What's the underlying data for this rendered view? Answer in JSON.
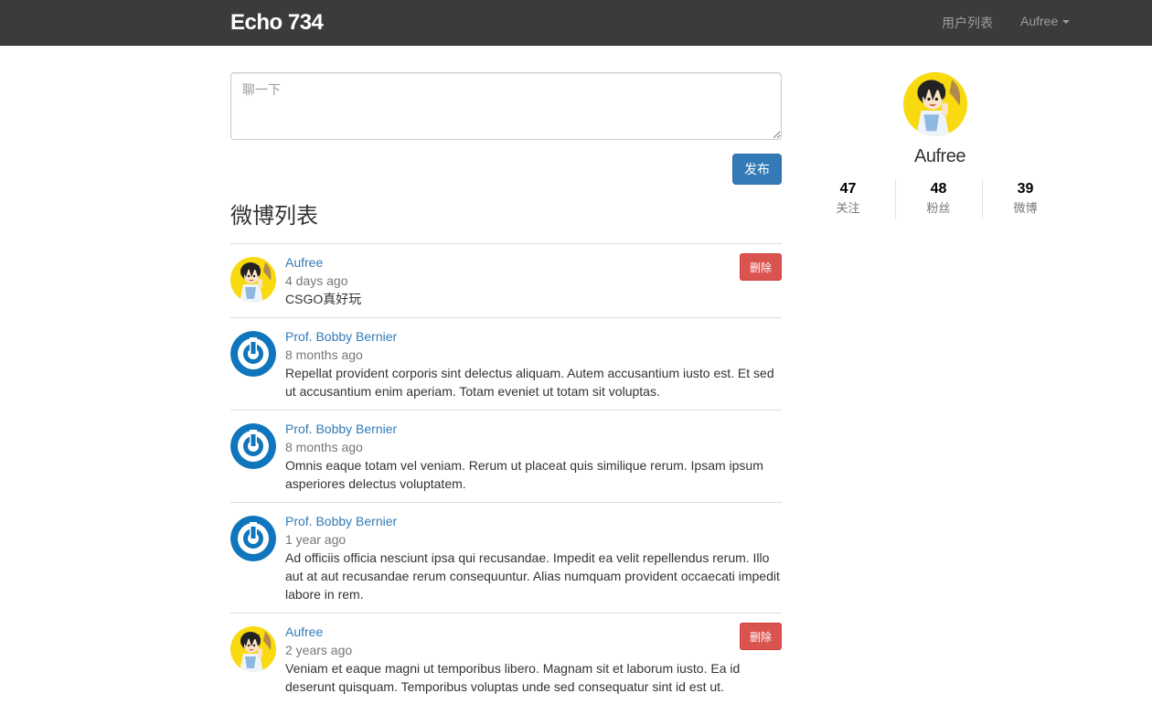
{
  "navbar": {
    "brand": "Echo 734",
    "users_link": "用户列表",
    "current_user": "Aufree"
  },
  "composer": {
    "placeholder": "聊一下",
    "submit_label": "发布"
  },
  "feed": {
    "title": "微博列表",
    "delete_label": "删除",
    "items": [
      {
        "author": "Aufree",
        "time": "4 days ago",
        "content": "CSGO真好玩",
        "avatar": "cartoon-avatar",
        "deletable": true
      },
      {
        "author": "Prof. Bobby Bernier",
        "time": "8 months ago",
        "content": "Repellat provident corporis sint delectus aliquam. Autem accusantium iusto est. Et sed ut accusantium enim aperiam. Totam eveniet ut totam sit voluptas.",
        "avatar": "gravatar-default-icon",
        "deletable": false
      },
      {
        "author": "Prof. Bobby Bernier",
        "time": "8 months ago",
        "content": "Omnis eaque totam vel veniam. Rerum ut placeat quis similique rerum. Ipsam ipsum asperiores delectus voluptatem.",
        "avatar": "gravatar-default-icon",
        "deletable": false
      },
      {
        "author": "Prof. Bobby Bernier",
        "time": "1 year ago",
        "content": "Ad officiis officia nesciunt ipsa qui recusandae. Impedit ea velit repellendus rerum. Illo aut at aut recusandae rerum consequuntur. Alias numquam provident occaecati impedit labore in rem.",
        "avatar": "gravatar-default-icon",
        "deletable": false
      },
      {
        "author": "Aufree",
        "time": "2 years ago",
        "content": "Veniam et eaque magni ut temporibus libero. Magnam sit et laborum iusto. Ea id deserunt quisquam. Temporibus voluptas unde sed consequatur sint id est ut.",
        "avatar": "cartoon-avatar",
        "deletable": true
      }
    ]
  },
  "profile": {
    "name": "Aufree",
    "stats": [
      {
        "count": "47",
        "label": "关注"
      },
      {
        "count": "48",
        "label": "粉丝"
      },
      {
        "count": "39",
        "label": "微博"
      }
    ]
  },
  "colors": {
    "navbar_bg": "#3b3b3d",
    "link": "#337ab7",
    "primary_button": "#337ab7",
    "danger_button": "#d9534f",
    "gravatar_blue": "#0f75bc",
    "cartoon_bg": "#f9d90f"
  }
}
